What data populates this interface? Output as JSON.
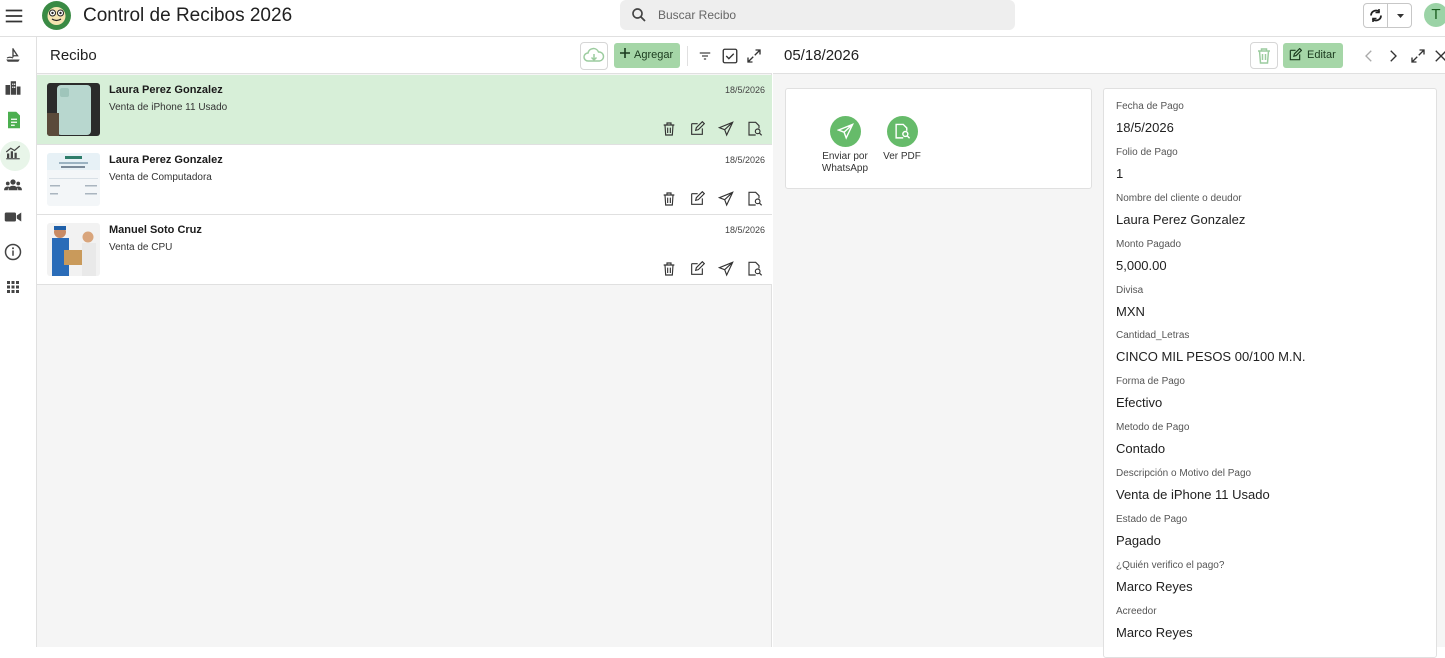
{
  "app": {
    "title": "Control de Recibos 2026",
    "avatar_initial": "T"
  },
  "search": {
    "placeholder": "Buscar Recibo"
  },
  "rail": {
    "items": [
      "ship-icon",
      "buildings-icon",
      "document-icon",
      "chart-icon",
      "people-icon",
      "video-icon",
      "info-icon",
      "apps-grid-icon"
    ],
    "active": "document-icon"
  },
  "list": {
    "title": "Recibo",
    "add_label": "Agregar",
    "rows": [
      {
        "name": "Laura Perez Gonzalez",
        "desc": "Venta de iPhone 11 Usado",
        "date": "18/5/2026",
        "selected": true
      },
      {
        "name": "Laura Perez Gonzalez",
        "desc": "Venta de Computadora",
        "date": "18/5/2026",
        "selected": false
      },
      {
        "name": "Manuel Soto Cruz",
        "desc": "Venta de CPU",
        "date": "18/5/2026",
        "selected": false
      }
    ]
  },
  "detail": {
    "title": "05/18/2026",
    "edit_label": "Editar",
    "actions": [
      {
        "label": "Enviar por WhatsApp",
        "icon": "send-icon"
      },
      {
        "label": "Ver PDF",
        "icon": "pdf-search-icon"
      }
    ],
    "fields": [
      {
        "label": "Fecha de Pago",
        "value": "18/5/2026"
      },
      {
        "label": "Folio de Pago",
        "value": "1"
      },
      {
        "label": "Nombre del cliente o deudor",
        "value": "Laura Perez Gonzalez"
      },
      {
        "label": "Monto Pagado",
        "value": "5,000.00"
      },
      {
        "label": "Divisa",
        "value": "MXN"
      },
      {
        "label": "Cantidad_Letras",
        "value": "CINCO MIL PESOS 00/100 M.N."
      },
      {
        "label": "Forma de Pago",
        "value": "Efectivo"
      },
      {
        "label": "Metodo de Pago",
        "value": "Contado"
      },
      {
        "label": "Descripción o Motivo del Pago",
        "value": "Venta de iPhone 11 Usado"
      },
      {
        "label": "Estado de Pago",
        "value": "Pagado"
      },
      {
        "label": "¿Quién verifico el pago?",
        "value": "Marco Reyes"
      },
      {
        "label": "Acreedor",
        "value": "Marco Reyes"
      }
    ]
  },
  "colors": {
    "accent": "#a5d6a7",
    "selected_row": "#d7efd8",
    "icon_green": "#66bb6a"
  }
}
